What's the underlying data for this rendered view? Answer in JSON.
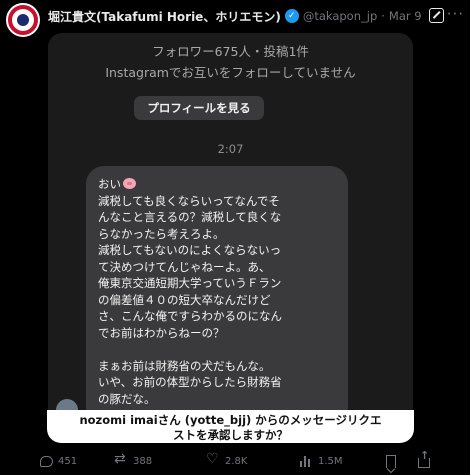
{
  "tweet": {
    "author_name": "堀江貴文(Takafumi Horie、ホリエモン)",
    "verified_mark": "✓",
    "handle": "@takapon_jp",
    "separator": "·",
    "date": "Mar 9",
    "more": "···"
  },
  "dm": {
    "followers_line": "フォロワー675人・投稿1件",
    "instagram_note": "Instagramでお互いをフォローしていません",
    "profile_button": "プロフィールを見る",
    "timestamp": "2:07",
    "message_lines": [
      "おい",
      "減税しても良くならいってなんでそ",
      "んなこと言えるの？減税して良くな",
      "らなかったら考えろよ。",
      "減税してもないのによくならないっ",
      "て決めつけてんじゃねーよ。あ、",
      "俺東京交通短期大学っていうＦラン",
      "の偏差値４０の短大卒なんだけど",
      "さ、こんな俺ですらわかるのになん",
      "でお前はわからねーの？",
      "",
      "まぁお前は財務省の犬だもんな。",
      "いや、お前の体型からしたら財務省",
      "の豚だな。"
    ],
    "request_line1": "nozomi imaiさん (yotte_bjj) からのメッセージリクエ",
    "request_line2": "ストを承認しますか？"
  },
  "actions": {
    "replies": "451",
    "reposts": "388",
    "likes": "2.8K",
    "views": "1.5M"
  },
  "icons": {
    "verified": "verified-badge-icon",
    "grok": "grok-icon",
    "reply": "reply-icon",
    "repost": "repost-icon",
    "like": "heart-icon",
    "views": "views-bar-chart-icon",
    "bookmark": "bookmark-icon",
    "share": "share-icon",
    "pig": "pig-emoji-icon"
  },
  "colors": {
    "background": "#000000",
    "verified": "#1d9bf0",
    "bubble": "#3a3a3c",
    "muted": "#71767b"
  }
}
